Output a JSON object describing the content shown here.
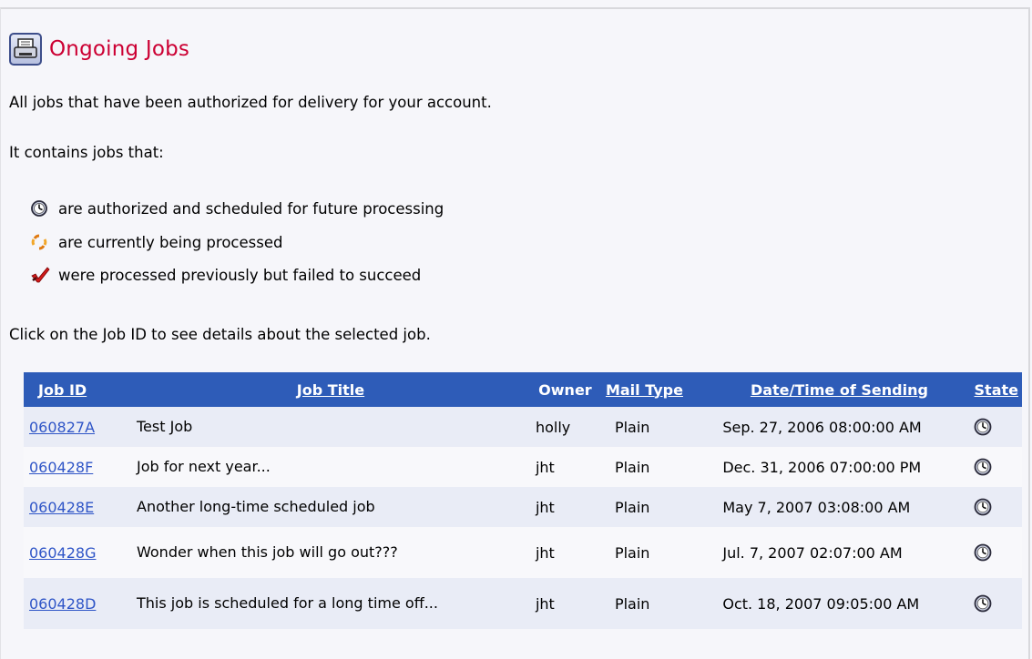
{
  "page": {
    "title": "Ongoing Jobs",
    "header_icon": "printer-icon",
    "description": "All jobs that have been authorized for delivery for your account.",
    "contains_label": "It contains jobs that:",
    "legend": [
      {
        "icon": "clock-icon",
        "text": "are authorized and scheduled for future processing"
      },
      {
        "icon": "refresh-icon",
        "text": "are currently being processed"
      },
      {
        "icon": "failed-x-icon",
        "text": "were processed previously but failed to succeed"
      }
    ],
    "instruction": "Click on the Job ID to see details about the selected job."
  },
  "table": {
    "columns": [
      "Job ID",
      "Job Title",
      "Owner",
      "Mail Type",
      "Date/Time of Sending",
      "State"
    ],
    "rows": [
      {
        "job_id": "060827A",
        "title": "Test Job",
        "owner": "holly",
        "mail_type": "Plain",
        "datetime": "Sep. 27, 2006 08:00:00 AM",
        "state": "clock-icon"
      },
      {
        "job_id": "060428F",
        "title": "Job for next year...",
        "owner": "jht",
        "mail_type": "Plain",
        "datetime": "Dec. 31, 2006 07:00:00 PM",
        "state": "clock-icon"
      },
      {
        "job_id": "060428E",
        "title": "Another long-time scheduled job",
        "owner": "jht",
        "mail_type": "Plain",
        "datetime": "May 7, 2007 03:08:00 AM",
        "state": "clock-icon"
      },
      {
        "job_id": "060428G",
        "title": "Wonder when this job will go out???",
        "owner": "jht",
        "mail_type": "Plain",
        "datetime": "Jul. 7, 2007 02:07:00 AM",
        "state": "clock-icon"
      },
      {
        "job_id": "060428D",
        "title": "This job is scheduled for a long time off...",
        "owner": "jht",
        "mail_type": "Plain",
        "datetime": "Oct. 18, 2007 09:05:00 AM",
        "state": "clock-icon"
      }
    ]
  },
  "colors": {
    "title": "#cc0033",
    "table_header": "#2e5cb8",
    "link": "#2f55c7",
    "row_odd": "#e9ecf6",
    "row_even": "#f8f8fb"
  }
}
